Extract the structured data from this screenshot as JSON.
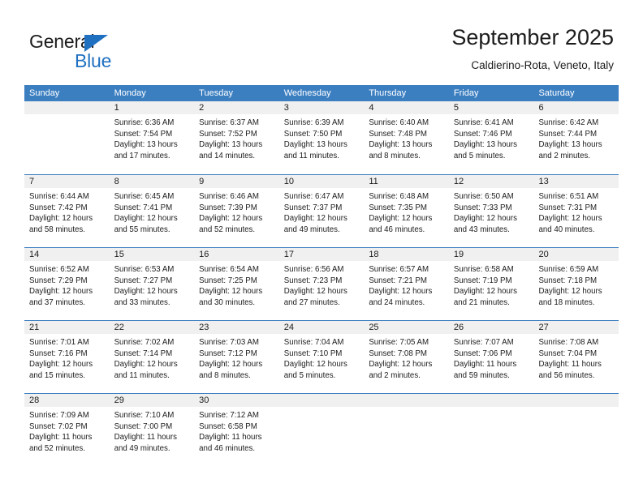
{
  "brand": {
    "name_part1": "General",
    "name_part2": "Blue",
    "triangle_icon": "blue-triangle-icon",
    "accent_color": "#1f70c1"
  },
  "header": {
    "month_title": "September 2025",
    "location": "Caldierino-Rota, Veneto, Italy"
  },
  "calendar": {
    "header_bg_color": "#3c7fc1",
    "day_band_color": "#f0f0f0",
    "weekdays": [
      "Sunday",
      "Monday",
      "Tuesday",
      "Wednesday",
      "Thursday",
      "Friday",
      "Saturday"
    ],
    "weeks": [
      [
        {
          "day": "",
          "lines": []
        },
        {
          "day": "1",
          "lines": [
            "Sunrise: 6:36 AM",
            "Sunset: 7:54 PM",
            "Daylight: 13 hours",
            "and 17 minutes."
          ]
        },
        {
          "day": "2",
          "lines": [
            "Sunrise: 6:37 AM",
            "Sunset: 7:52 PM",
            "Daylight: 13 hours",
            "and 14 minutes."
          ]
        },
        {
          "day": "3",
          "lines": [
            "Sunrise: 6:39 AM",
            "Sunset: 7:50 PM",
            "Daylight: 13 hours",
            "and 11 minutes."
          ]
        },
        {
          "day": "4",
          "lines": [
            "Sunrise: 6:40 AM",
            "Sunset: 7:48 PM",
            "Daylight: 13 hours",
            "and 8 minutes."
          ]
        },
        {
          "day": "5",
          "lines": [
            "Sunrise: 6:41 AM",
            "Sunset: 7:46 PM",
            "Daylight: 13 hours",
            "and 5 minutes."
          ]
        },
        {
          "day": "6",
          "lines": [
            "Sunrise: 6:42 AM",
            "Sunset: 7:44 PM",
            "Daylight: 13 hours",
            "and 2 minutes."
          ]
        }
      ],
      [
        {
          "day": "7",
          "lines": [
            "Sunrise: 6:44 AM",
            "Sunset: 7:42 PM",
            "Daylight: 12 hours",
            "and 58 minutes."
          ]
        },
        {
          "day": "8",
          "lines": [
            "Sunrise: 6:45 AM",
            "Sunset: 7:41 PM",
            "Daylight: 12 hours",
            "and 55 minutes."
          ]
        },
        {
          "day": "9",
          "lines": [
            "Sunrise: 6:46 AM",
            "Sunset: 7:39 PM",
            "Daylight: 12 hours",
            "and 52 minutes."
          ]
        },
        {
          "day": "10",
          "lines": [
            "Sunrise: 6:47 AM",
            "Sunset: 7:37 PM",
            "Daylight: 12 hours",
            "and 49 minutes."
          ]
        },
        {
          "day": "11",
          "lines": [
            "Sunrise: 6:48 AM",
            "Sunset: 7:35 PM",
            "Daylight: 12 hours",
            "and 46 minutes."
          ]
        },
        {
          "day": "12",
          "lines": [
            "Sunrise: 6:50 AM",
            "Sunset: 7:33 PM",
            "Daylight: 12 hours",
            "and 43 minutes."
          ]
        },
        {
          "day": "13",
          "lines": [
            "Sunrise: 6:51 AM",
            "Sunset: 7:31 PM",
            "Daylight: 12 hours",
            "and 40 minutes."
          ]
        }
      ],
      [
        {
          "day": "14",
          "lines": [
            "Sunrise: 6:52 AM",
            "Sunset: 7:29 PM",
            "Daylight: 12 hours",
            "and 37 minutes."
          ]
        },
        {
          "day": "15",
          "lines": [
            "Sunrise: 6:53 AM",
            "Sunset: 7:27 PM",
            "Daylight: 12 hours",
            "and 33 minutes."
          ]
        },
        {
          "day": "16",
          "lines": [
            "Sunrise: 6:54 AM",
            "Sunset: 7:25 PM",
            "Daylight: 12 hours",
            "and 30 minutes."
          ]
        },
        {
          "day": "17",
          "lines": [
            "Sunrise: 6:56 AM",
            "Sunset: 7:23 PM",
            "Daylight: 12 hours",
            "and 27 minutes."
          ]
        },
        {
          "day": "18",
          "lines": [
            "Sunrise: 6:57 AM",
            "Sunset: 7:21 PM",
            "Daylight: 12 hours",
            "and 24 minutes."
          ]
        },
        {
          "day": "19",
          "lines": [
            "Sunrise: 6:58 AM",
            "Sunset: 7:19 PM",
            "Daylight: 12 hours",
            "and 21 minutes."
          ]
        },
        {
          "day": "20",
          "lines": [
            "Sunrise: 6:59 AM",
            "Sunset: 7:18 PM",
            "Daylight: 12 hours",
            "and 18 minutes."
          ]
        }
      ],
      [
        {
          "day": "21",
          "lines": [
            "Sunrise: 7:01 AM",
            "Sunset: 7:16 PM",
            "Daylight: 12 hours",
            "and 15 minutes."
          ]
        },
        {
          "day": "22",
          "lines": [
            "Sunrise: 7:02 AM",
            "Sunset: 7:14 PM",
            "Daylight: 12 hours",
            "and 11 minutes."
          ]
        },
        {
          "day": "23",
          "lines": [
            "Sunrise: 7:03 AM",
            "Sunset: 7:12 PM",
            "Daylight: 12 hours",
            "and 8 minutes."
          ]
        },
        {
          "day": "24",
          "lines": [
            "Sunrise: 7:04 AM",
            "Sunset: 7:10 PM",
            "Daylight: 12 hours",
            "and 5 minutes."
          ]
        },
        {
          "day": "25",
          "lines": [
            "Sunrise: 7:05 AM",
            "Sunset: 7:08 PM",
            "Daylight: 12 hours",
            "and 2 minutes."
          ]
        },
        {
          "day": "26",
          "lines": [
            "Sunrise: 7:07 AM",
            "Sunset: 7:06 PM",
            "Daylight: 11 hours",
            "and 59 minutes."
          ]
        },
        {
          "day": "27",
          "lines": [
            "Sunrise: 7:08 AM",
            "Sunset: 7:04 PM",
            "Daylight: 11 hours",
            "and 56 minutes."
          ]
        }
      ],
      [
        {
          "day": "28",
          "lines": [
            "Sunrise: 7:09 AM",
            "Sunset: 7:02 PM",
            "Daylight: 11 hours",
            "and 52 minutes."
          ]
        },
        {
          "day": "29",
          "lines": [
            "Sunrise: 7:10 AM",
            "Sunset: 7:00 PM",
            "Daylight: 11 hours",
            "and 49 minutes."
          ]
        },
        {
          "day": "30",
          "lines": [
            "Sunrise: 7:12 AM",
            "Sunset: 6:58 PM",
            "Daylight: 11 hours",
            "and 46 minutes."
          ]
        },
        {
          "day": "",
          "lines": []
        },
        {
          "day": "",
          "lines": []
        },
        {
          "day": "",
          "lines": []
        },
        {
          "day": "",
          "lines": []
        }
      ]
    ]
  }
}
